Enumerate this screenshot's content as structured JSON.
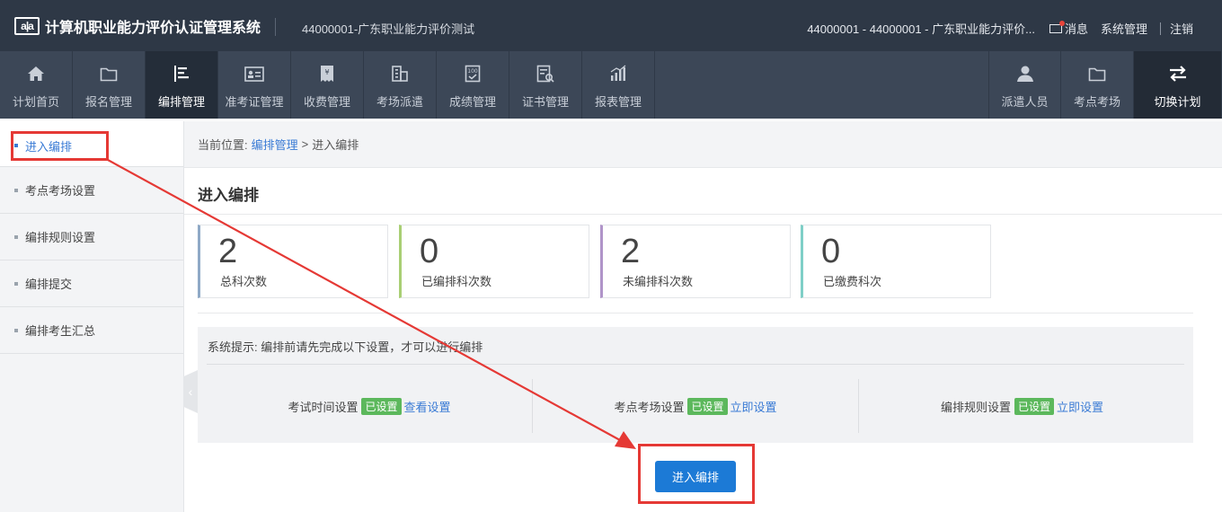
{
  "header": {
    "logo_text": "a|a",
    "title": "计算机职业能力评价认证管理系统",
    "org": "44000001-广东职业能力评价测试",
    "account": "44000001 - 44000001 - 广东职业能力评价...",
    "messages": "消息",
    "system_admin": "系统管理",
    "logout": "注销"
  },
  "nav": {
    "items": [
      {
        "label": "计划首页",
        "icon": "home-icon"
      },
      {
        "label": "报名管理",
        "icon": "folder-icon"
      },
      {
        "label": "编排管理",
        "icon": "schedule-icon"
      },
      {
        "label": "准考证管理",
        "icon": "id-card-icon"
      },
      {
        "label": "收费管理",
        "icon": "receipt-icon"
      },
      {
        "label": "考场派遣",
        "icon": "building-icon"
      },
      {
        "label": "成绩管理",
        "icon": "score-icon"
      },
      {
        "label": "证书管理",
        "icon": "certificate-icon"
      },
      {
        "label": "报表管理",
        "icon": "bar-chart-icon"
      }
    ],
    "right_items": [
      {
        "label": "派遣人员",
        "icon": "user-icon"
      },
      {
        "label": "考点考场",
        "icon": "folder-icon"
      },
      {
        "label": "切换计划",
        "icon": "swap-icon"
      }
    ]
  },
  "sidebar": {
    "items": [
      {
        "label": "进入编排"
      },
      {
        "label": "考点考场设置"
      },
      {
        "label": "编排规则设置"
      },
      {
        "label": "编排提交"
      },
      {
        "label": "编排考生汇总"
      }
    ]
  },
  "breadcrumb": {
    "prefix": "当前位置:",
    "parent": "编排管理",
    "separator": ">",
    "current": "进入编排"
  },
  "page": {
    "title": "进入编排",
    "stats": [
      {
        "value": "2",
        "label": "总科次数",
        "color": "#8fa9c6"
      },
      {
        "value": "0",
        "label": "已编排科次数",
        "color": "#a9cf74"
      },
      {
        "value": "2",
        "label": "未编排科次数",
        "color": "#b094c9"
      },
      {
        "value": "0",
        "label": "已缴费科次",
        "color": "#7fcfc7"
      }
    ],
    "tip": "系统提示: 编排前请先完成以下设置，才可以进行编排",
    "settings": [
      {
        "label": "考试时间设置",
        "badge": "已设置",
        "link": "查看设置"
      },
      {
        "label": "考点考场设置",
        "badge": "已设置",
        "link": "立即设置"
      },
      {
        "label": "编排规则设置",
        "badge": "已设置",
        "link": "立即设置"
      }
    ],
    "enter_button": "进入编排"
  },
  "colors": {
    "header_bg": "#2e3846",
    "nav_bg": "#3c4757",
    "accent": "#1c7ad6",
    "annotation": "#e53935"
  }
}
